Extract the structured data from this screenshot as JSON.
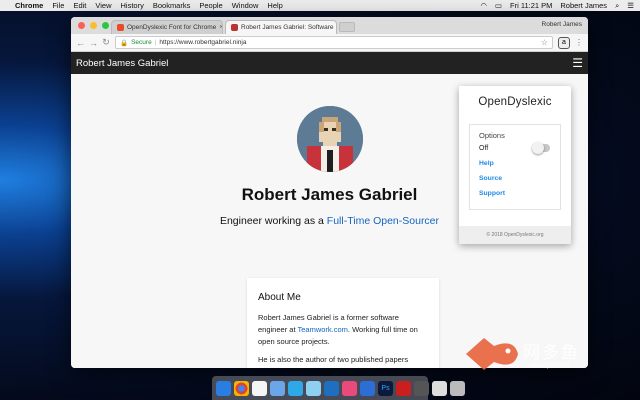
{
  "menubar": {
    "app": "Chrome",
    "items": [
      "File",
      "Edit",
      "View",
      "History",
      "Bookmarks",
      "People",
      "Window",
      "Help"
    ],
    "clock": "Fri 11:21 PM",
    "user": "Robert James"
  },
  "browser": {
    "tabs": [
      {
        "label": "OpenDyslexic Font for Chrome",
        "active": false
      },
      {
        "label": "Robert James Gabriel: Software",
        "active": true
      }
    ],
    "profile": "Robert James",
    "secure_label": "Secure",
    "url": "https://www.robertgabriel.ninja"
  },
  "site": {
    "nav_title": "Robert James Gabriel",
    "name": "Robert James Gabriel",
    "tagline_prefix": "Engineer working as a",
    "tagline_link": "Full-Time Open-Sourcer",
    "about": {
      "heading": "About Me",
      "p1_before": "Robert James Gabriel is a former software engineer at",
      "p1_link": "Teamwork.com",
      "p1_after": ". Working full time on open source projects.",
      "p2": "He is also the author of two published papers including 'Problems Posed by Ad-blockers' and 'Web Accessibility and OpenDyslexia'."
    }
  },
  "popup": {
    "title": "OpenDyslexic",
    "options_label": "Options",
    "toggle_state": "Off",
    "toggle_on": false,
    "links": [
      "Help",
      "Source",
      "Support"
    ],
    "footer": "© 2018 OpenDyslexic.org"
  },
  "watermark": {
    "text": "网多鱼",
    "sub": "wduoyu.com"
  },
  "colors": {
    "accent": "#1e88e5",
    "link": "#1565c0",
    "site_nav": "#222222"
  }
}
